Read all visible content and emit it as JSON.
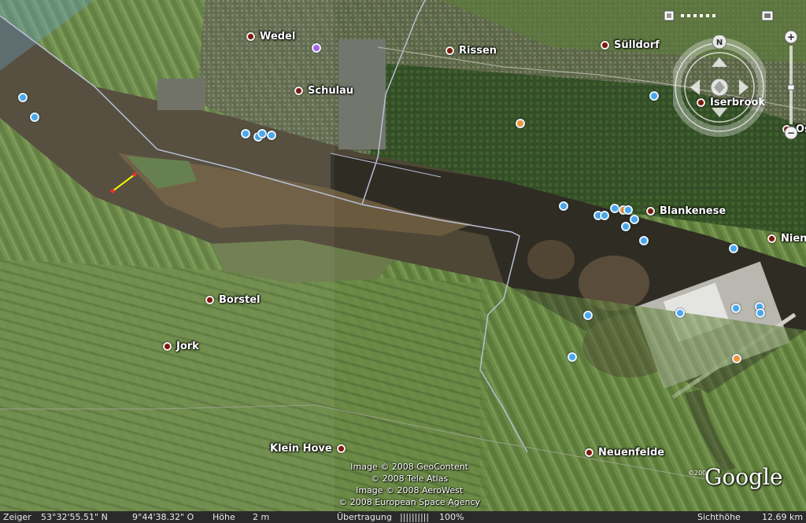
{
  "places": [
    {
      "id": "wedel",
      "name": "Wedel"
    },
    {
      "id": "schulau",
      "name": "Schulau"
    },
    {
      "id": "rissen",
      "name": "Rissen"
    },
    {
      "id": "sulldorf",
      "name": "Sülldorf"
    },
    {
      "id": "iserbrook",
      "name": "Iserbrook"
    },
    {
      "id": "os",
      "name": "Os"
    },
    {
      "id": "blankenese",
      "name": "Blankenese"
    },
    {
      "id": "nien",
      "name": "Nien"
    },
    {
      "id": "borstel",
      "name": "Borstel"
    },
    {
      "id": "jork",
      "name": "Jork"
    },
    {
      "id": "kleinhove",
      "name": "Klein Hove"
    },
    {
      "id": "neuenfelde",
      "name": "Neuenfelde"
    }
  ],
  "credits": [
    "Image © 2008 GeoContent",
    "© 2008 Tele Atlas",
    "Image © 2008 AeroWest",
    "© 2008 European Space Agency"
  ],
  "logo": {
    "text": "Google",
    "year": "©2007"
  },
  "status": {
    "pointer_label": "Zeiger",
    "lat": "53°32'55.51\" N",
    "lon": "9°44'38.32\" O",
    "height_label": "Höhe",
    "height_value": "2 m",
    "streaming_label": "Übertragung",
    "streaming_bar": "||||||||||",
    "streaming_percent": "100%",
    "eye_label": "Sichthöhe",
    "eye_value": "12.69 km"
  },
  "nav": {
    "north_letter": "N"
  },
  "zoom": {
    "plus": "+",
    "minus": "−"
  },
  "colors": {
    "water": "#4e4736",
    "land_green": "#5e7a3c",
    "poi_blue": "#49a7ec",
    "poi_orange": "#f1933b",
    "measure_line": "#ffff00"
  },
  "icons": [
    "hand-icon",
    "look-joystick-icon",
    "move-joystick-icon",
    "north-up-icon",
    "zoom-slider-icon"
  ]
}
